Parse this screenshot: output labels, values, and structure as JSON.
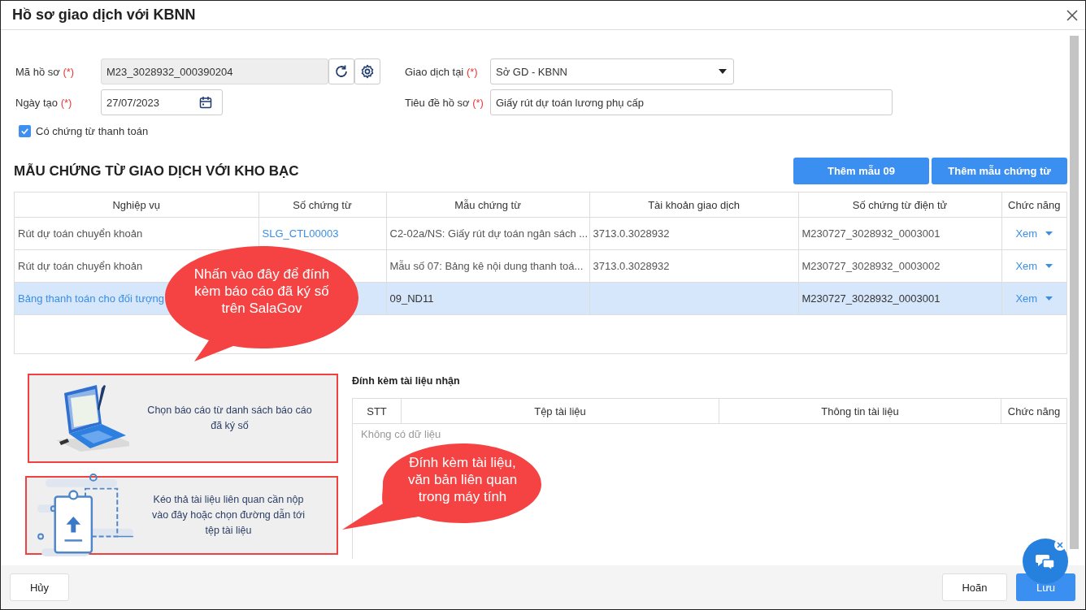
{
  "window": {
    "title": "Hồ sơ giao dịch với KBNN"
  },
  "form": {
    "left": [
      {
        "kind": "code",
        "label": "Mã hồ sơ",
        "required": "(*)",
        "value": "M23_3028932_000390204"
      },
      {
        "kind": "date",
        "label": "Ngày tạo",
        "required": "(*)",
        "value": "27/07/2023"
      }
    ],
    "right": [
      {
        "kind": "select",
        "label": "Giao dịch tại",
        "required": "(*)",
        "value": "Sở GD - KBNN"
      },
      {
        "kind": "text",
        "label": "Tiêu đề hồ sơ",
        "required": "(*)",
        "value": "Giấy rút dự toán lương phụ cấp"
      }
    ],
    "checkbox": {
      "label": "Có chứng từ thanh toán",
      "checked": true
    }
  },
  "section": {
    "title": "MẪU CHỨNG TỪ GIAO DỊCH VỚI KHO BẠC",
    "buttons": [
      "Thêm mẫu 09",
      "Thêm mẫu chứng từ"
    ]
  },
  "table": {
    "columns": [
      "Nghiệp vụ",
      "Số chứng từ",
      "Mẫu chứng từ",
      "Tài khoản giao dịch",
      "Số chứng từ điện tử",
      "Chức năng"
    ],
    "rows": [
      {
        "selected": false,
        "cells": [
          {
            "text": "Rút dự toán chuyển khoản",
            "link": false
          },
          {
            "text": "SLG_CTL00003",
            "link": true
          },
          {
            "text": "C2-02a/NS: Giấy rút dự toán ngân sách ...",
            "link": false
          },
          {
            "text": "3713.0.3028932",
            "link": false
          },
          {
            "text": "M230727_3028932_0003001",
            "link": false
          }
        ],
        "action": "Xem"
      },
      {
        "selected": false,
        "cells": [
          {
            "text": "Rút dự toán chuyển khoản",
            "link": false
          },
          {},
          {
            "text": "Mẫu số 07: Bảng kê nội dung thanh toá...",
            "link": false
          },
          {
            "text": "3713.0.3028932",
            "link": false
          },
          {
            "text": "M230727_3028932_0003002",
            "link": false
          }
        ],
        "action": "Xem"
      },
      {
        "selected": true,
        "cells": [
          {
            "text": "Bảng thanh toán cho đối tượng",
            "link": true
          },
          {},
          {
            "text": "09_ND11",
            "link": false
          },
          {},
          {
            "text": "M230727_3028932_0003001",
            "link": false
          }
        ],
        "action": "Xem"
      }
    ]
  },
  "attach_options": [
    {
      "kind": "signed",
      "text": "Chọn báo cáo từ danh sách báo cáo đã ký số",
      "highlighted": true
    },
    {
      "kind": "upload",
      "text": "Kéo thả tài liệu liên quan cần nộp vào đây hoặc chọn đường dẫn tới tệp tài liệu",
      "highlighted": true
    }
  ],
  "received": {
    "title": "Đính kèm tài liệu nhận",
    "columns": [
      "STT",
      "Tệp tài liệu",
      "Thông tin tài liệu",
      "Chức năng"
    ],
    "empty": "Không có dữ liệu"
  },
  "callouts": [
    {
      "text": "Nhấn vào đây để đính kèm báo cáo đã ký số trên SalaGov"
    },
    {
      "text": "Đính kèm tài liệu, văn bản liên quan trong máy tính"
    }
  ],
  "footer": {
    "buttons": [
      {
        "label": "Hủy",
        "kind": "cancel"
      },
      {
        "label": "Hoãn",
        "kind": "secondary"
      },
      {
        "label": "Lưu",
        "kind": "primary"
      }
    ]
  }
}
